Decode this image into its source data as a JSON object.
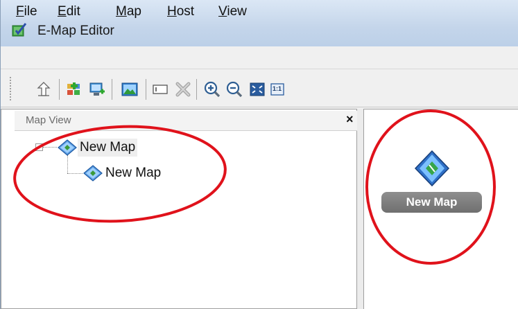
{
  "window": {
    "title": "E-Map Editor"
  },
  "menu": [
    {
      "label": "File",
      "mnemonic": "F",
      "rest": "ile"
    },
    {
      "label": "Edit",
      "mnemonic": "E",
      "rest": "dit"
    },
    {
      "label": "Map",
      "mnemonic": "M",
      "rest": "ap"
    },
    {
      "label": "Host",
      "mnemonic": "H",
      "rest": "ost"
    },
    {
      "label": "View",
      "mnemonic": "V",
      "rest": "iew"
    }
  ],
  "toolbar": [
    {
      "icon": "up-arrow-icon"
    },
    {
      "icon": "add-map-icon"
    },
    {
      "icon": "add-host-icon"
    },
    {
      "icon": "image-icon"
    },
    {
      "icon": "rename-icon"
    },
    {
      "icon": "delete-icon"
    },
    {
      "icon": "zoom-in-icon"
    },
    {
      "icon": "zoom-out-icon"
    },
    {
      "icon": "fit-to-window-icon"
    },
    {
      "icon": "actual-size-icon",
      "text": "1:1"
    }
  ],
  "map_view": {
    "title": "Map View",
    "close": "×",
    "tree": [
      {
        "label": "New Map",
        "selected": true,
        "children": [
          {
            "label": "New Map"
          }
        ]
      }
    ]
  },
  "canvas": {
    "map_label": "New Map"
  },
  "colors": {
    "annotation": "#e0121b",
    "title_bar": "#c4d5ea",
    "map_pill": "#7a7a7a"
  }
}
